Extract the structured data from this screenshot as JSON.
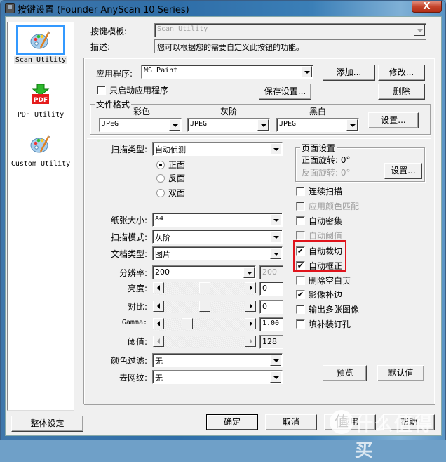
{
  "window": {
    "title": "按键设置 (Founder AnyScan 10 Series)",
    "close_label": "X"
  },
  "sidebar": {
    "items": [
      {
        "label": "Scan Utility",
        "icon": "palette-icon",
        "selected": true
      },
      {
        "label": "PDF Utility",
        "icon": "pdf-icon",
        "selected": false
      },
      {
        "label": "Custom Utility",
        "icon": "palette-icon",
        "selected": false
      }
    ],
    "global_settings_label": "整体设定"
  },
  "header": {
    "template_label": "按键模板:",
    "template_value": "Scan Utility",
    "desc_label": "描述:",
    "desc_value": "您可以根据您的需要自定义此按钮的功能。"
  },
  "app": {
    "label": "应用程序:",
    "value": "MS Paint",
    "add_label": "添加...",
    "modify_label": "修改...",
    "delete_label": "删除",
    "launch_only_label": "只启动应用程序",
    "launch_only_checked": false,
    "save_settings_label": "保存设置..."
  },
  "file_format": {
    "title": "文件格式",
    "color_label": "彩色",
    "color_value": "JPEG",
    "gray_label": "灰阶",
    "gray_value": "JPEG",
    "bw_label": "黑白",
    "bw_value": "JPEG",
    "settings_label": "设置..."
  },
  "scan": {
    "scan_type_label": "扫描类型:",
    "scan_type_value": "自动侦测",
    "sides": [
      {
        "label": "正面",
        "selected": true
      },
      {
        "label": "反面",
        "selected": false
      },
      {
        "label": "双面",
        "selected": false
      }
    ],
    "paper_size_label": "纸张大小:",
    "paper_size_value": "A4",
    "scan_mode_label": "扫描模式:",
    "scan_mode_value": "灰阶",
    "doc_type_label": "文档类型:",
    "doc_type_value": "图片",
    "resolution_label": "分辨率:",
    "resolution_value": "200",
    "resolution_readout": "200",
    "brightness_label": "亮度:",
    "brightness_value": "0",
    "brightness_position": 0.5,
    "contrast_label": "对比:",
    "contrast_value": "0",
    "contrast_position": 0.5,
    "gamma_label": "Gamma:",
    "gamma_value": "1.00",
    "gamma_position": 0.25,
    "threshold_label": "阈值:",
    "threshold_value": "128",
    "color_filter_label": "颜色过滤:",
    "color_filter_value": "无",
    "descreen_label": "去网纹:",
    "descreen_value": "无"
  },
  "page_setup": {
    "title": "页面设置",
    "front_rotation": "正面旋转: 0°",
    "back_rotation": "反面旋转: 0°",
    "settings_label": "设置..."
  },
  "options": [
    {
      "label": "连续扫描",
      "checked": false,
      "disabled": false
    },
    {
      "label": "应用颜色匹配",
      "checked": false,
      "disabled": true
    },
    {
      "label": "自动密集",
      "checked": false,
      "disabled": false
    },
    {
      "label": "自动阈值",
      "checked": false,
      "disabled": true
    },
    {
      "label": "自动裁切",
      "checked": true,
      "disabled": false
    },
    {
      "label": "自动框正",
      "checked": true,
      "disabled": false
    },
    {
      "label": "删除空白页",
      "checked": false,
      "disabled": false
    },
    {
      "label": "影像补边",
      "checked": true,
      "disabled": false
    },
    {
      "label": "输出多张图像",
      "checked": false,
      "disabled": false
    },
    {
      "label": "填补装订孔",
      "checked": false,
      "disabled": false
    }
  ],
  "actions": {
    "preview_label": "预览",
    "default_label": "默认值",
    "ok_label": "确定",
    "cancel_label": "取消",
    "apply_label": "应用",
    "help_label": "帮助"
  },
  "watermark": {
    "badge": "值",
    "text": "什么值得买"
  },
  "highlight_color": "#e0141c"
}
